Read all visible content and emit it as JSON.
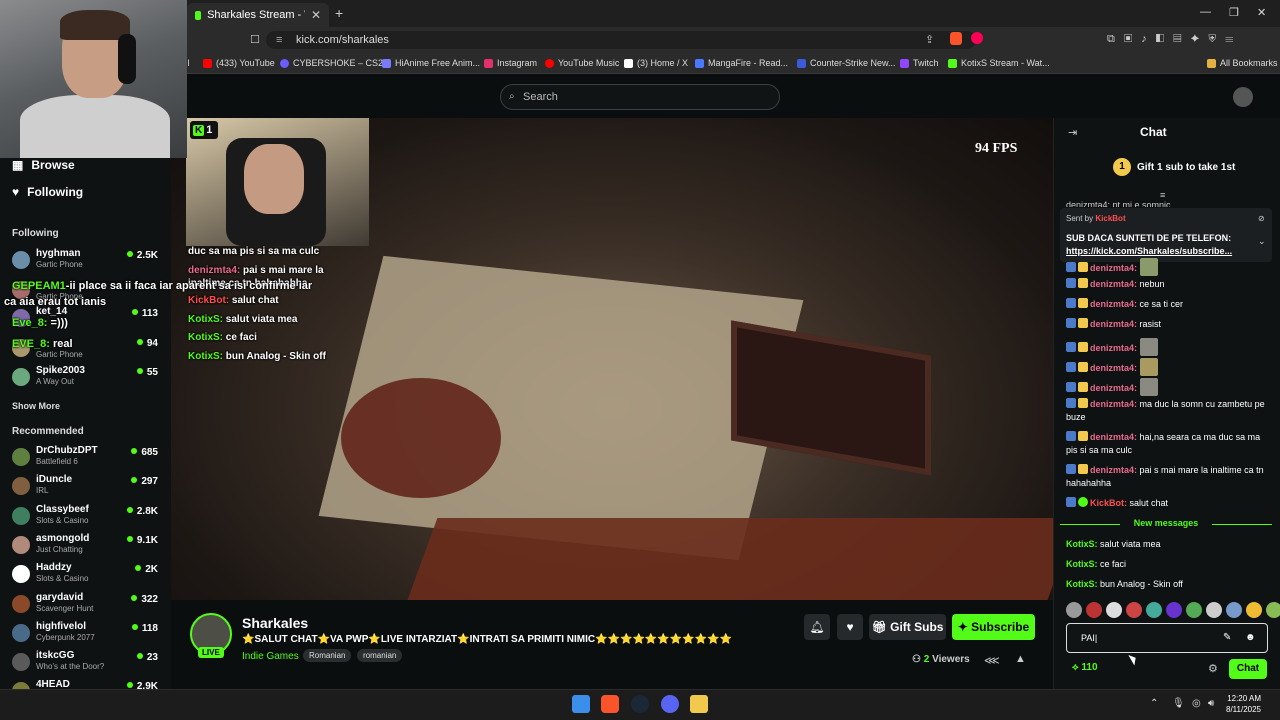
{
  "browser": {
    "tab_title": "Sharkales Stream - Watch Liv",
    "url": "kick.com/sharkales",
    "bookmarks": [
      {
        "label": "(433) YouTube",
        "color": "#ff0000"
      },
      {
        "label": "CYBERSHOKE – CS2...",
        "color": "#6b5cff"
      },
      {
        "label": "HiAnime Free Anim...",
        "color": "#7a7aff"
      },
      {
        "label": "Instagram",
        "color": "#e1306c"
      },
      {
        "label": "YouTube Music",
        "color": "#ff0000"
      },
      {
        "label": "(3) Home / X",
        "color": "#ffffff"
      },
      {
        "label": "MangaFire - Read...",
        "color": "#4a78ff"
      },
      {
        "label": "Counter-Strike New...",
        "color": "#3b5bdb"
      },
      {
        "label": "Twitch",
        "color": "#9146ff"
      },
      {
        "label": "KotixS Stream - Wat...",
        "color": "#53fc18"
      }
    ],
    "all_bookmarks": "All Bookmarks"
  },
  "header": {
    "search_placeholder": "Search"
  },
  "sidebar": {
    "browse": "Browse",
    "following_nav": "Following",
    "following_heading": "Following",
    "following": [
      {
        "name": "hyghman",
        "game": "Gartic Phone",
        "viewers": "2.5K",
        "color": "#6b8ea8"
      },
      {
        "name": "",
        "game": "Gartic Phone",
        "viewers": "",
        "color": "#a86b6b"
      },
      {
        "name": "ket_14",
        "game": "",
        "viewers": "113",
        "color": "#7d6ba8"
      },
      {
        "name": "",
        "game": "Gartic Phone",
        "viewers": "94",
        "color": "#a8986b"
      },
      {
        "name": "Spike2003",
        "game": "A Way Out",
        "viewers": "55",
        "color": "#6ba87d"
      }
    ],
    "show_more": "Show More",
    "recommended_heading": "Recommended",
    "recommended": [
      {
        "name": "DrChubzDPT",
        "game": "Battlefield 6",
        "viewers": "685",
        "color": "#5f7f3f"
      },
      {
        "name": "iDuncle",
        "game": "IRL",
        "viewers": "297",
        "color": "#7f5f3f"
      },
      {
        "name": "Classybeef",
        "game": "Slots & Casino",
        "viewers": "2.8K",
        "color": "#3f7f5f"
      },
      {
        "name": "asmongold",
        "game": "Just Chatting",
        "viewers": "9.1K",
        "color": "#b08a7a"
      },
      {
        "name": "Haddzy",
        "game": "Slots & Casino",
        "viewers": "2K",
        "color": "#ffffff"
      },
      {
        "name": "garydavid",
        "game": "Scavenger Hunt",
        "viewers": "322",
        "color": "#8a4a2a"
      },
      {
        "name": "highfivelol",
        "game": "Cyberpunk 2077",
        "viewers": "118",
        "color": "#4a6a8a"
      },
      {
        "name": "itskcGG",
        "game": "Who's at the Door?",
        "viewers": "23",
        "color": "#5a5a5a"
      },
      {
        "name": "4HEAD",
        "game": "",
        "viewers": "2.9K",
        "color": "#7a7a3a"
      }
    ]
  },
  "video": {
    "viewer_badge": "1",
    "fps": "94 FPS",
    "overlay_chat": [
      {
        "text": "duc sa ma pis si sa ma culc",
        "color": "#ffffff"
      },
      {
        "user": "denizmta4:",
        "text": "pai s mai mare la inaltime ca tn hahahahha",
        "color": "#e86a8e"
      },
      {
        "user": "KickBot:",
        "text": "salut chat",
        "color": "#ff4d4d"
      },
      {
        "user": "KotixS:",
        "text": "salut viata mea",
        "color": "#53fc18"
      },
      {
        "user": "KotixS:",
        "text": "ce faci",
        "color": "#53fc18"
      },
      {
        "user": "KotixS:",
        "text": "bun Analog - Skin off",
        "color": "#53fc18"
      }
    ],
    "overlay_left": [
      {
        "user": "GEPEAM1",
        "text": "-ii place sa ii faca iar aparent sa isi confirme iar"
      },
      {
        "user": "",
        "text": "ca aia erau tot ianis"
      },
      {
        "user": "Eve_8:",
        "text": "=)))"
      },
      {
        "user": "EVE_8:",
        "text": "real"
      }
    ]
  },
  "stream": {
    "live": "LIVE",
    "name": "Sharkales",
    "title": "⭐SALUT CHAT⭐VA PWP⭐LIVE INTARZIAT⭐INTRATI SA PRIMITI NIMIC⭐⭐⭐⭐⭐⭐⭐⭐⭐⭐⭐",
    "category": "Indie Games",
    "tags": [
      "Romanian",
      "romanian"
    ],
    "gift_subs": "Gift Subs",
    "subscribe": "Subscribe",
    "viewers_count": "2",
    "viewers_label": "Viewers"
  },
  "chat": {
    "title": "Chat",
    "gift_banner": "Gift 1 sub to take 1st",
    "gift_number": "1",
    "pinned_sent_by": "Sent by",
    "pinned_sender": "KickBot",
    "pinned_message": "SUB DACA SUNTETI DE PE TELEFON:",
    "pinned_link": "https://kick.com/Sharkales/subscribe...",
    "partial_top": "denizmta4: pt mi e somnic",
    "messages": [
      {
        "user": "denizmta4:",
        "text": "",
        "emote": true,
        "color": "pink"
      },
      {
        "user": "denizmta4:",
        "text": "nebun",
        "emote": false,
        "color": "pink"
      },
      {
        "user": "denizmta4:",
        "text": "ce sa ti cer",
        "emote": false,
        "color": "pink"
      },
      {
        "user": "denizmta4:",
        "text": "rasist",
        "emote": false,
        "color": "pink"
      },
      {
        "user": "denizmta4:",
        "text": "",
        "emote": true,
        "color": "pink"
      },
      {
        "user": "denizmta4:",
        "text": "",
        "emote": true,
        "color": "pink"
      },
      {
        "user": "denizmta4:",
        "text": "",
        "emote": true,
        "color": "pink"
      },
      {
        "user": "denizmta4:",
        "text": "ma duc la somn cu zambetu pe buze",
        "emote": false,
        "color": "pink"
      },
      {
        "user": "denizmta4:",
        "text": "hai,na seara ca ma duc sa ma pis si sa ma culc",
        "emote": false,
        "color": "pink"
      },
      {
        "user": "denizmta4:",
        "text": "pai s mai mare la inaltime ca tn hahahahha",
        "emote": false,
        "color": "pink"
      },
      {
        "user": "KickBot:",
        "text": "salut chat",
        "emote": false,
        "color": "red"
      }
    ],
    "new_messages": "New messages",
    "new": [
      {
        "user": "KotixS:",
        "text": "salut viata mea"
      },
      {
        "user": "KotixS:",
        "text": "ce faci"
      },
      {
        "user": "KotixS:",
        "text": "bun Analog - Skin off"
      }
    ],
    "input_value": "PAI",
    "points": "110",
    "send": "Chat"
  },
  "taskbar": {
    "time": "12:20 AM",
    "date": "8/11/2025"
  }
}
